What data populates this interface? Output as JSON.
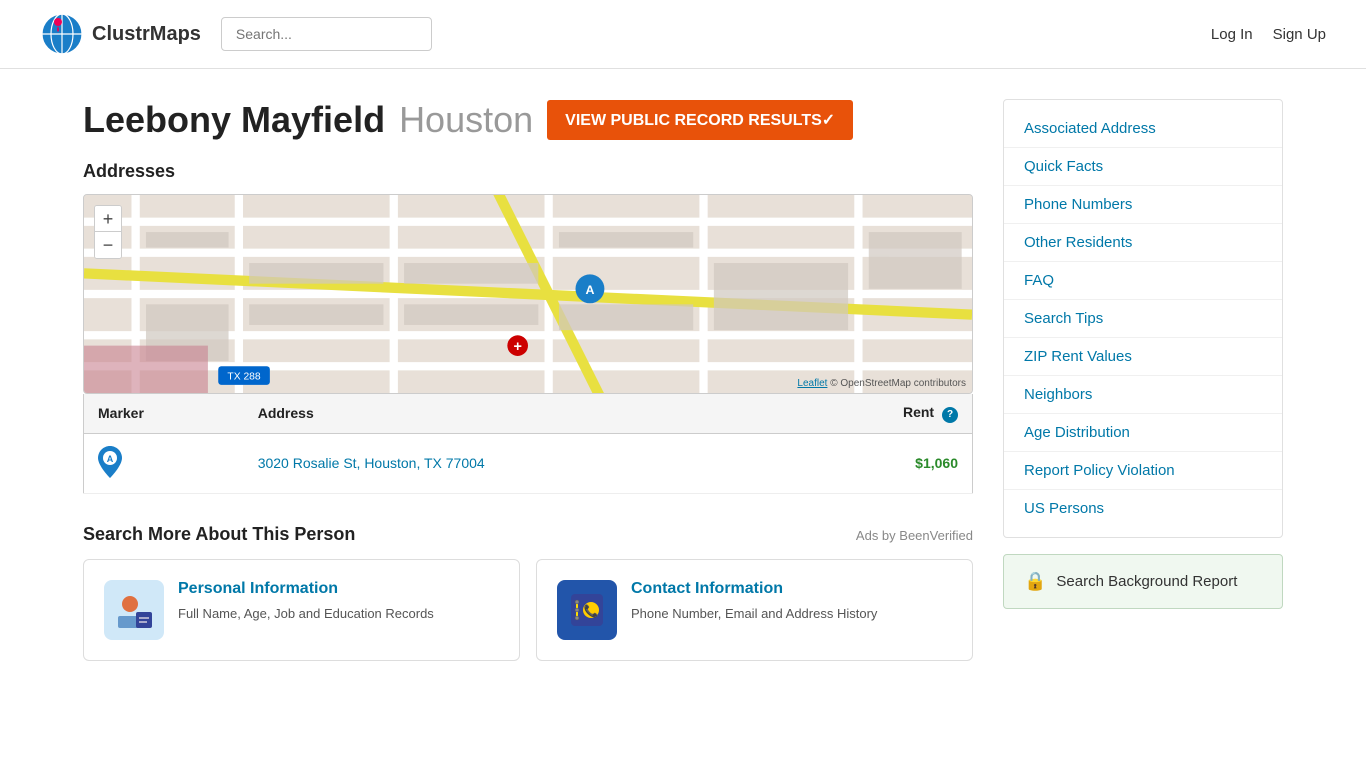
{
  "header": {
    "logo_text": "ClustrMaps",
    "search_placeholder": "Search...",
    "nav": {
      "login": "Log In",
      "signup": "Sign Up"
    }
  },
  "page": {
    "person_name": "Leebony Mayfield",
    "person_city": "Houston",
    "view_record_btn": "VIEW PUBLIC RECORD RESULTS✓"
  },
  "addresses": {
    "section_title": "Addresses",
    "table": {
      "col_marker": "Marker",
      "col_address": "Address",
      "col_rent": "Rent",
      "rows": [
        {
          "marker": "A",
          "address": "3020 Rosalie St, Houston, TX 77004",
          "rent": "$1,060"
        }
      ]
    }
  },
  "search_more": {
    "title": "Search More About This Person",
    "ads_label": "Ads by BeenVerified",
    "cards": [
      {
        "id": "personal",
        "title": "Personal Information",
        "description": "Full Name, Age, Job and Education Records",
        "icon_type": "personal"
      },
      {
        "id": "contact",
        "title": "Contact Information",
        "description": "Phone Number, Email and Address History",
        "icon_type": "contact"
      }
    ]
  },
  "sidebar": {
    "links": [
      {
        "label": "Associated Address",
        "href": "#"
      },
      {
        "label": "Quick Facts",
        "href": "#"
      },
      {
        "label": "Phone Numbers",
        "href": "#"
      },
      {
        "label": "Other Residents",
        "href": "#"
      },
      {
        "label": "FAQ",
        "href": "#"
      },
      {
        "label": "Search Tips",
        "href": "#"
      },
      {
        "label": "ZIP Rent Values",
        "href": "#"
      },
      {
        "label": "Neighbors",
        "href": "#"
      },
      {
        "label": "Age Distribution",
        "href": "#"
      },
      {
        "label": "Report Policy Violation",
        "href": "#"
      },
      {
        "label": "US Persons",
        "href": "#"
      }
    ],
    "bg_report_btn": "Search Background Report"
  },
  "map": {
    "attribution_leaflet": "Leaflet",
    "attribution_osm": "© OpenStreetMap contributors",
    "zoom_in": "+",
    "zoom_out": "−"
  }
}
